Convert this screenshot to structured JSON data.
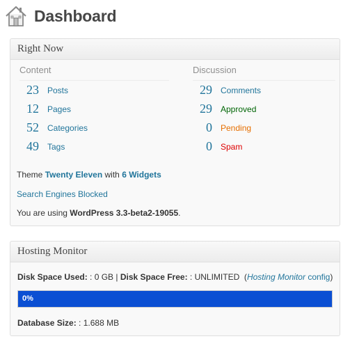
{
  "header": {
    "title": "Dashboard",
    "icon": "home-icon"
  },
  "right_now": {
    "title": "Right Now",
    "content": {
      "heading": "Content",
      "rows": [
        {
          "count": "23",
          "label": "Posts"
        },
        {
          "count": "12",
          "label": "Pages"
        },
        {
          "count": "52",
          "label": "Categories"
        },
        {
          "count": "49",
          "label": "Tags"
        }
      ]
    },
    "discussion": {
      "heading": "Discussion",
      "rows": [
        {
          "count": "29",
          "label": "Comments"
        },
        {
          "count": "29",
          "label": "Approved"
        },
        {
          "count": "0",
          "label": "Pending"
        },
        {
          "count": "0",
          "label": "Spam"
        }
      ]
    },
    "theme_prefix": "Theme ",
    "theme_name": "Twenty Eleven",
    "theme_mid": " with ",
    "widgets_link": "6 Widgets",
    "seo_link": "Search Engines Blocked",
    "version_prefix": "You are using ",
    "version": "WordPress 3.3-beta2-19055",
    "version_suffix": "."
  },
  "hosting_monitor": {
    "title": "Hosting Monitor",
    "disk_used_label": "Disk Space Used: ",
    "disk_used_value": ": 0 GB | ",
    "disk_free_label": "Disk Space Free: ",
    "disk_free_value": ": UNLIMITED  (",
    "config_link_name": "Hosting Monitor",
    "config_link_suffix": " config",
    "close_paren": ")",
    "progress": 0,
    "progress_text": "0%",
    "db_label": "Database Size: ",
    "db_value": ": 1.688 MB"
  },
  "colors": {
    "link": "#21759b",
    "approved": "#006505",
    "pending": "#e66f00",
    "spam": "#dd0000",
    "progress_bar": "#0b4fd3"
  }
}
